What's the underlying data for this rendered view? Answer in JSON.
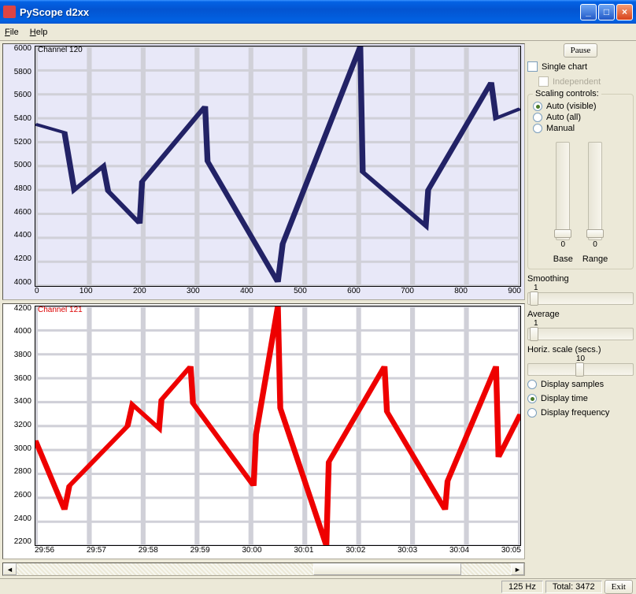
{
  "window": {
    "title": "PyScope d2xx"
  },
  "menu": {
    "file": "File",
    "help": "Help"
  },
  "sidebar": {
    "pause": "Pause",
    "single_chart": "Single chart",
    "independent": "Independent",
    "scaling_title": "Scaling controls:",
    "scaling": {
      "auto_visible": "Auto (visible)",
      "auto_all": "Auto (all)",
      "manual": "Manual"
    },
    "vslider1_val": "0",
    "vslider1_label": "Base",
    "vslider2_val": "0",
    "vslider2_label": "Range",
    "smoothing_label": "Smoothing",
    "smoothing_val": "1",
    "average_label": "Average",
    "average_val": "1",
    "horiz_label": "Horiz. scale (secs.)",
    "horiz_val": "10",
    "disp_samples": "Display samples",
    "disp_time": "Display time",
    "disp_freq": "Display frequency"
  },
  "status": {
    "hz": "125 Hz",
    "total": "Total: 3472",
    "exit": "Exit"
  },
  "chart_data": [
    {
      "type": "line",
      "title": "Channel 120",
      "color": "#222266",
      "ylim": [
        4000,
        6000
      ],
      "yticks": [
        6000,
        5800,
        5600,
        5400,
        5200,
        5000,
        4800,
        4600,
        4400,
        4200,
        4000
      ],
      "xticks": [
        "0",
        "100",
        "200",
        "300",
        "400",
        "500",
        "600",
        "700",
        "800",
        "900"
      ],
      "x": [
        0,
        60,
        80,
        140,
        150,
        215,
        220,
        350,
        355,
        500,
        510,
        670,
        675,
        805,
        810,
        940,
        950,
        1000
      ],
      "y": [
        5350,
        5280,
        4800,
        5000,
        4790,
        4520,
        4870,
        5500,
        5040,
        4030,
        4350,
        6000,
        4950,
        4500,
        4800,
        5700,
        5400,
        5480
      ]
    },
    {
      "type": "line",
      "title": "Channel 121",
      "color": "#ee0000",
      "ylim": [
        2200,
        4200
      ],
      "yticks": [
        4200,
        4000,
        3800,
        3600,
        3400,
        3200,
        3000,
        2800,
        2600,
        2400,
        2200
      ],
      "xticks": [
        "29:56",
        "29:57",
        "29:58",
        "29:59",
        "30:00",
        "30:01",
        "30:02",
        "30:03",
        "30:04",
        "30:05"
      ],
      "x": [
        0,
        0.6,
        0.7,
        1.9,
        2.0,
        2.55,
        2.6,
        3.2,
        3.25,
        4.5,
        4.55,
        5.0,
        5.05,
        6.0,
        6.05,
        7.2,
        7.25,
        8.45,
        8.5,
        9.5,
        9.55,
        10
      ],
      "y": [
        3080,
        2500,
        2700,
        3200,
        3380,
        3180,
        3420,
        3700,
        3390,
        2700,
        3130,
        4200,
        3350,
        2200,
        2900,
        3700,
        3320,
        2500,
        2740,
        3700,
        2940,
        3300
      ]
    }
  ]
}
